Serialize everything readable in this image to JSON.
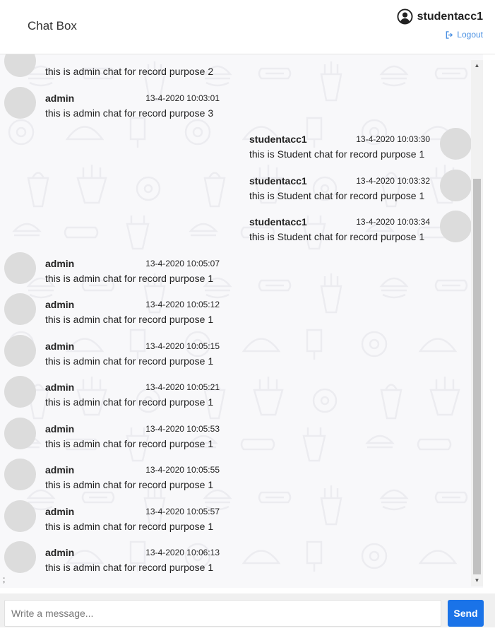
{
  "header": {
    "title": "Chat Box",
    "username": "studentacc1",
    "logout_label": "Logout",
    "user_icon": "user-circle-icon",
    "logout_icon": "sign-out-icon"
  },
  "messages": [
    {
      "side": "left",
      "name": "",
      "time": "",
      "text": "this is admin chat for record purpose 2"
    },
    {
      "side": "left",
      "name": "admin",
      "time": "13-4-2020 10:03:01",
      "text": "this is admin chat for record purpose 3"
    },
    {
      "side": "right",
      "name": "studentacc1",
      "time": "13-4-2020 10:03:30",
      "text": "this is Student chat for record purpose 1"
    },
    {
      "side": "right",
      "name": "studentacc1",
      "time": "13-4-2020 10:03:32",
      "text": "this is Student chat for record purpose 1"
    },
    {
      "side": "right",
      "name": "studentacc1",
      "time": "13-4-2020 10:03:34",
      "text": "this is Student chat for record purpose 1"
    },
    {
      "side": "left",
      "name": "admin",
      "time": "13-4-2020 10:05:07",
      "text": "this is admin chat for record purpose 1"
    },
    {
      "side": "left",
      "name": "admin",
      "time": "13-4-2020 10:05:12",
      "text": "this is admin chat for record purpose 1"
    },
    {
      "side": "left",
      "name": "admin",
      "time": "13-4-2020 10:05:15",
      "text": "this is admin chat for record purpose 1"
    },
    {
      "side": "left",
      "name": "admin",
      "time": "13-4-2020 10:05:21",
      "text": "this is admin chat for record purpose 1"
    },
    {
      "side": "left",
      "name": "admin",
      "time": "13-4-2020 10:05:53",
      "text": "this is admin chat for record purpose 1"
    },
    {
      "side": "left",
      "name": "admin",
      "time": "13-4-2020 10:05:55",
      "text": "this is admin chat for record purpose 1"
    },
    {
      "side": "left",
      "name": "admin",
      "time": "13-4-2020 10:05:57",
      "text": "this is admin chat for record purpose 1"
    },
    {
      "side": "left",
      "name": "admin",
      "time": "13-4-2020 10:06:13",
      "text": "this is admin chat for record purpose 1"
    }
  ],
  "stray_text": ";",
  "composer": {
    "placeholder": "Write a message...",
    "value": "",
    "send_label": "Send"
  },
  "colors": {
    "accent": "#1a73e8",
    "link": "#4a90e2",
    "avatar": "#dcdcdc",
    "chat_bg": "#f8f8fa"
  }
}
